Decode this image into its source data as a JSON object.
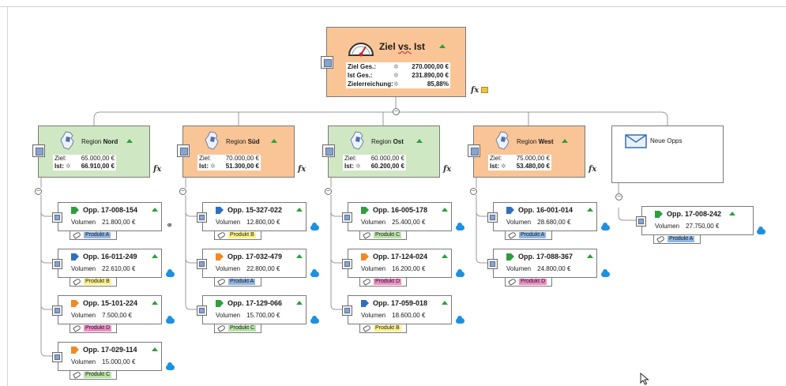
{
  "root": {
    "title_prefix": "Ziel ",
    "title_vs": "vs.",
    "title_suffix": " Ist",
    "rows": [
      {
        "label": "Ziel Ges.:",
        "value": "270.000,00 €"
      },
      {
        "label": "Ist Ges.:",
        "value": "231.890,00 €"
      },
      {
        "label": "Zielerreichung:",
        "value": "85,88%"
      }
    ],
    "fx": "fx"
  },
  "regions": [
    {
      "prefix": "Region ",
      "name": "Nord",
      "color": "green",
      "ziel_label": "Ziel:",
      "ziel": "65.000,00 €",
      "ist_label": "Ist:",
      "ist": "66.910,00 €",
      "fx": "fx"
    },
    {
      "prefix": "Region ",
      "name": "Süd",
      "color": "orange",
      "ziel_label": "Ziel:",
      "ziel": "70.000,00 €",
      "ist_label": "Ist:",
      "ist": "51.300,00 €",
      "fx": "fx"
    },
    {
      "prefix": "Region ",
      "name": "Ost",
      "color": "green",
      "ziel_label": "Ziel:",
      "ziel": "60.000,00 €",
      "ist_label": "Ist:",
      "ist": "60.200,00 €",
      "fx": "fx"
    },
    {
      "prefix": "Region ",
      "name": "West",
      "color": "orange",
      "ziel_label": "Ziel:",
      "ziel": "75.000,00 €",
      "ist_label": "Ist:",
      "ist": "53.480,00 €",
      "fx": "fx"
    }
  ],
  "neue_opps": {
    "label": "Neue Opps"
  },
  "opps": [
    {
      "region": 0,
      "title": "Opp. 17-008-154",
      "flag_color": "#2e9e3e",
      "vol_label": "Volumen",
      "volume": "21.800,00 €",
      "product": "Produkt A",
      "product_class": "c-A"
    },
    {
      "region": 0,
      "title": "Opp. 16-011-249",
      "flag_color": "#2f6fc0",
      "vol_label": "Volumen",
      "volume": "22.610,00 €",
      "product": "Produkt B",
      "product_class": "c-B"
    },
    {
      "region": 0,
      "title": "Opp. 15-101-224",
      "flag_color": "#f08a24",
      "vol_label": "Volumen",
      "volume": "7.500,00 €",
      "product": "Produkt D",
      "product_class": "c-D"
    },
    {
      "region": 0,
      "title": "Opp. 17-029-114",
      "flag_color": "#f08a24",
      "vol_label": "Volumen",
      "volume": "15.000,00 €",
      "product": "Produkt C",
      "product_class": "c-C"
    },
    {
      "region": 1,
      "title": "Opp. 15-327-022",
      "flag_color": "#2f6fc0",
      "vol_label": "Volumen",
      "volume": "12.800,00 €",
      "product": "Produkt B",
      "product_class": "c-B"
    },
    {
      "region": 1,
      "title": "Opp. 17-032-479",
      "flag_color": "#f08a24",
      "vol_label": "Volumen",
      "volume": "22.800,00 €",
      "product": "Produkt A",
      "product_class": "c-A"
    },
    {
      "region": 1,
      "title": "Opp. 17-129-066",
      "flag_color": "#2e9e3e",
      "vol_label": "Volumen",
      "volume": "15.700,00 €",
      "product": "Produkt C",
      "product_class": "c-C"
    },
    {
      "region": 2,
      "title": "Opp. 16-005-178",
      "flag_color": "#2e9e3e",
      "vol_label": "Volumen",
      "volume": "25.400,00 €",
      "product": "Produkt C",
      "product_class": "c-C"
    },
    {
      "region": 2,
      "title": "Opp. 17-124-024",
      "flag_color": "#f08a24",
      "vol_label": "Volumen",
      "volume": "16.200,00 €",
      "product": "Produkt D",
      "product_class": "c-D"
    },
    {
      "region": 2,
      "title": "Opp. 17-059-018",
      "flag_color": "#2f6fc0",
      "vol_label": "Volumen",
      "volume": "18.600,00 €",
      "product": "Produkt B",
      "product_class": "c-B"
    },
    {
      "region": 3,
      "title": "Opp. 16-001-014",
      "flag_color": "#2f6fc0",
      "vol_label": "Volumen",
      "volume": "28.680,00 €",
      "product": "Produkt A",
      "product_class": "c-A"
    },
    {
      "region": 3,
      "title": "Opp. 17-088-367",
      "flag_color": "#2e9e3e",
      "vol_label": "Volumen",
      "volume": "24.800,00 €",
      "product": "Produkt D",
      "product_class": "c-D"
    },
    {
      "region": 4,
      "title": "Opp. 17-008-242",
      "flag_color": "#2e9e3e",
      "vol_label": "Volumen",
      "volume": "27.750,00 €",
      "product": "Produkt A",
      "product_class": "c-A"
    }
  ],
  "colors": {
    "orange": "#f9c596",
    "green": "#cfe7c3",
    "up_arrow": "#2e9e3e",
    "cloud": "#1e90e0"
  },
  "icons": {
    "gauge": "gauge-icon",
    "map": "region-map-icon",
    "note": "note-icon",
    "formula": "fx-icon",
    "tag": "tag-icon",
    "link": "link-icon",
    "envelope": "envelope-icon",
    "cloud": "cloud-icon",
    "cursor": "cursor-icon"
  }
}
